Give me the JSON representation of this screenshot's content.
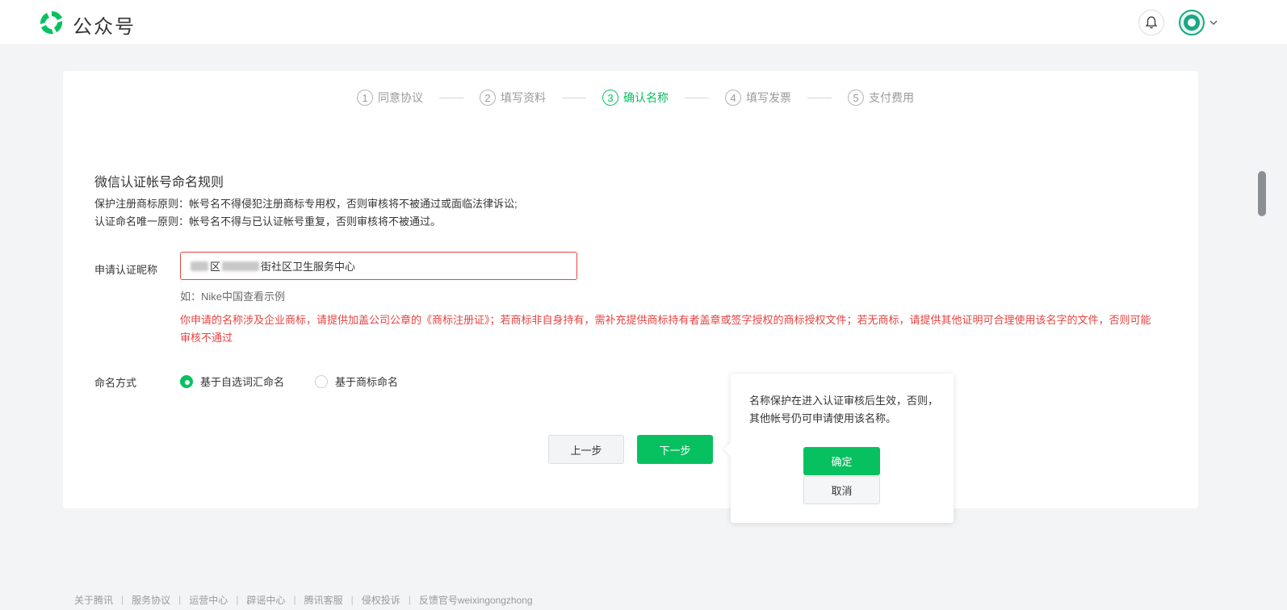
{
  "header": {
    "brand": "公众号",
    "colors": {
      "brand_green": "#07c160",
      "logo_green": "#1aad19"
    },
    "icons": {
      "logo": "wechat-official-logo-icon",
      "bell": "bell-icon",
      "avatar": "account-avatar",
      "chevron": "chevron-down-icon"
    }
  },
  "steps": [
    {
      "num": "1",
      "label": "同意协议",
      "active": false
    },
    {
      "num": "2",
      "label": "填写资料",
      "active": false
    },
    {
      "num": "3",
      "label": "确认名称",
      "active": true
    },
    {
      "num": "4",
      "label": "填写发票",
      "active": false
    },
    {
      "num": "5",
      "label": "支付费用",
      "active": false
    }
  ],
  "rules": {
    "title": "微信认证帐号命名规则",
    "line1": "保护注册商标原则：帐号名不得侵犯注册商标专用权，否则审核将不被通过或面临法律诉讼;",
    "line2": "认证命名唯一原则：帐号名不得与已认证帐号重复，否则审核将不被通过。"
  },
  "form": {
    "nickname_label": "申请认证昵称",
    "nickname_value_part1": "区",
    "nickname_value_part2": "街社区卫生服务中心",
    "hint": "如：Nike中国查看示例",
    "warning": "你申请的名称涉及企业商标，请提供加盖公司公章的《商标注册证》；若商标非自身持有，需补充提供商标持有者盖章或签字授权的商标授权文件；若无商标，请提供其他证明可合理使用该名字的文件，否则可能审核不通过",
    "mode_label": "命名方式",
    "mode_options": [
      {
        "label": "基于自选词汇命名",
        "checked": true
      },
      {
        "label": "基于商标命名",
        "checked": false
      }
    ],
    "prev_label": "上一步",
    "next_label": "下一步"
  },
  "popover": {
    "text": "名称保护在进入认证审核后生效，否则，其他帐号仍可申请使用该名称。",
    "ok_label": "确定",
    "cancel_label": "取消"
  },
  "footer": {
    "links": [
      "关于腾讯",
      "服务协议",
      "运营中心",
      "辟谣中心",
      "腾讯客服",
      "侵权投诉",
      "反馈官号weixingongzhong"
    ]
  }
}
